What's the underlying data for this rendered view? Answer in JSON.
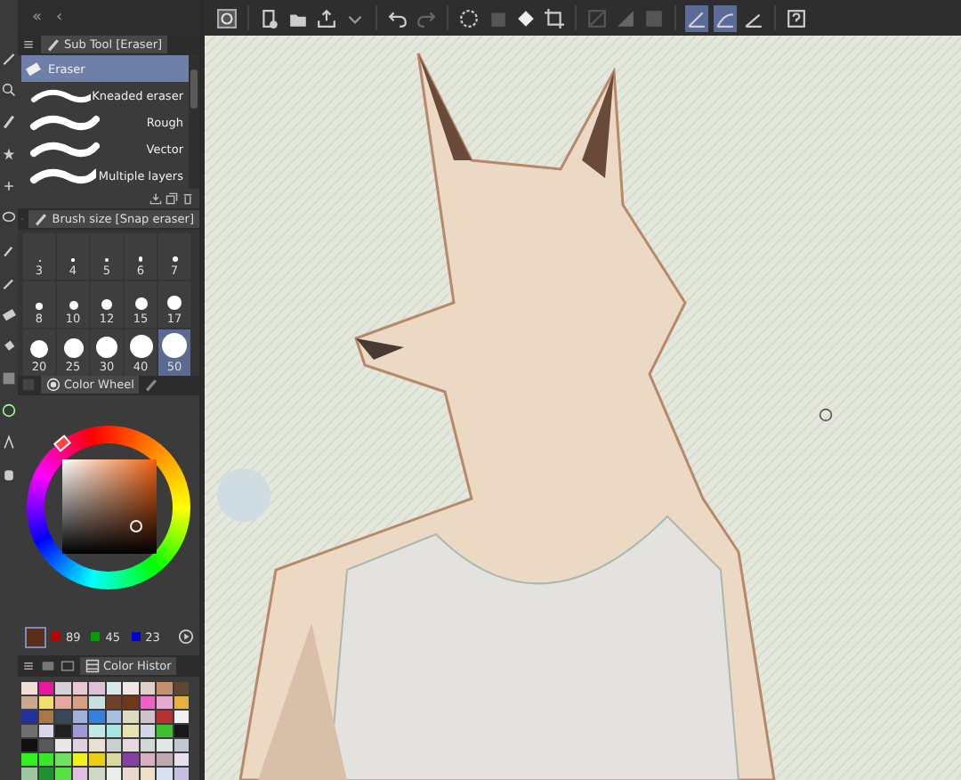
{
  "panel_nav": [
    "«",
    "‹"
  ],
  "sub_tool": {
    "tab": "Sub Tool [Eraser]",
    "items": [
      {
        "label": "Eraser",
        "kind": "header",
        "selected": true
      },
      {
        "label": "Kneaded eraser",
        "kind": "stroke",
        "selected": false
      },
      {
        "label": "Rough",
        "kind": "stroke",
        "selected": false
      },
      {
        "label": "Vector",
        "kind": "stroke",
        "selected": false
      },
      {
        "label": "Multiple layers",
        "kind": "stroke",
        "selected": false
      }
    ]
  },
  "brush_size": {
    "tab": "Brush size [Snap eraser]",
    "sizes": [
      {
        "label": "3",
        "selected": false
      },
      {
        "label": "4",
        "selected": false
      },
      {
        "label": "5",
        "selected": false
      },
      {
        "label": "6",
        "selected": false
      },
      {
        "label": "7",
        "selected": false
      },
      {
        "label": "8",
        "selected": false
      },
      {
        "label": "10",
        "selected": false
      },
      {
        "label": "12",
        "selected": false
      },
      {
        "label": "15",
        "selected": false
      },
      {
        "label": "17",
        "selected": false
      },
      {
        "label": "20",
        "selected": false
      },
      {
        "label": "25",
        "selected": false
      },
      {
        "label": "30",
        "selected": false
      },
      {
        "label": "40",
        "selected": false
      },
      {
        "label": "50",
        "selected": true
      }
    ]
  },
  "color_wheel": {
    "tab": "Color Wheel",
    "color": "#592d17",
    "rgb": [
      "89",
      "45",
      "23"
    ]
  },
  "color_history": {
    "tab": "Color Histor",
    "swatches": [
      {
        "color": "#f0e0d8"
      },
      {
        "color": "#e8189c"
      },
      {
        "color": "#d8d0d8"
      },
      {
        "color": "#e8c8d0"
      },
      {
        "color": "#e0c0d8"
      },
      {
        "color": "#d8e8e8"
      },
      {
        "color": "#f0e8e0"
      },
      {
        "color": "#e0d0c8"
      },
      {
        "color": "#c89070"
      },
      {
        "color": "#604830"
      },
      {
        "color": "#c8a890"
      },
      {
        "color": "#f0e070"
      },
      {
        "color": "#e8a8a0"
      },
      {
        "color": "#d8a080"
      },
      {
        "color": "#c8e0e0"
      },
      {
        "color": "#704028"
      },
      {
        "color": "#703818"
      },
      {
        "color": "#f060c8"
      },
      {
        "color": "#e8a8d0"
      },
      {
        "color": "#e8b040"
      },
      {
        "color": "#2030a0"
      },
      {
        "color": "#a87848"
      },
      {
        "color": "#384858"
      },
      {
        "color": "#a0b0d8"
      },
      {
        "color": "#3880e0"
      },
      {
        "color": "#a8c0e0"
      },
      {
        "color": "#e0d8c0"
      },
      {
        "color": "#d0c0d0"
      },
      {
        "color": "#b83030"
      },
      {
        "color": "#f0f0f0"
      },
      {
        "color": "#707070"
      },
      {
        "color": "#d8d8e8"
      },
      {
        "color": "#202020"
      },
      {
        "color": "#a098d8"
      },
      {
        "color": "#c0e8e0"
      },
      {
        "color": "#a0e8e0"
      },
      {
        "color": "#e8e0b0"
      },
      {
        "color": "#d0d8e8"
      },
      {
        "color": "#40c030"
      },
      {
        "color": "#181818"
      },
      {
        "color": "#101010"
      },
      {
        "color": "#585858"
      },
      {
        "color": "#e8e8e8"
      },
      {
        "color": "#e0d0e0"
      },
      {
        "color": "#e8e0d0"
      },
      {
        "color": "#c8d0d0"
      },
      {
        "color": "#e8d8e0"
      },
      {
        "color": "#d0d8d8"
      },
      {
        "color": "#e0e8e8"
      },
      {
        "color": "#c0c8d0"
      },
      {
        "color": "#30f020"
      },
      {
        "color": "#38e828"
      },
      {
        "color": "#70e060"
      },
      {
        "color": "#f0f020"
      },
      {
        "color": "#e8d010"
      },
      {
        "color": "#d8d8a0"
      },
      {
        "color": "#8840a0"
      },
      {
        "color": "#d8b0c0"
      },
      {
        "color": "#c0a8b0"
      },
      {
        "color": "#e8e0e8"
      },
      {
        "color": "#a0c8a0"
      },
      {
        "color": "#209030"
      },
      {
        "color": "#58e048"
      },
      {
        "color": "#e0c0e0"
      },
      {
        "color": "#d0d8c8"
      },
      {
        "color": "#e8f0e8"
      },
      {
        "color": "#e8d8d0"
      },
      {
        "color": "#f0e0c8"
      },
      {
        "color": "#d8e0f0"
      },
      {
        "color": "#c8c0e0"
      }
    ]
  },
  "snap_buttons": [
    {
      "selected": true
    },
    {
      "selected": true
    },
    {
      "selected": false
    }
  ]
}
